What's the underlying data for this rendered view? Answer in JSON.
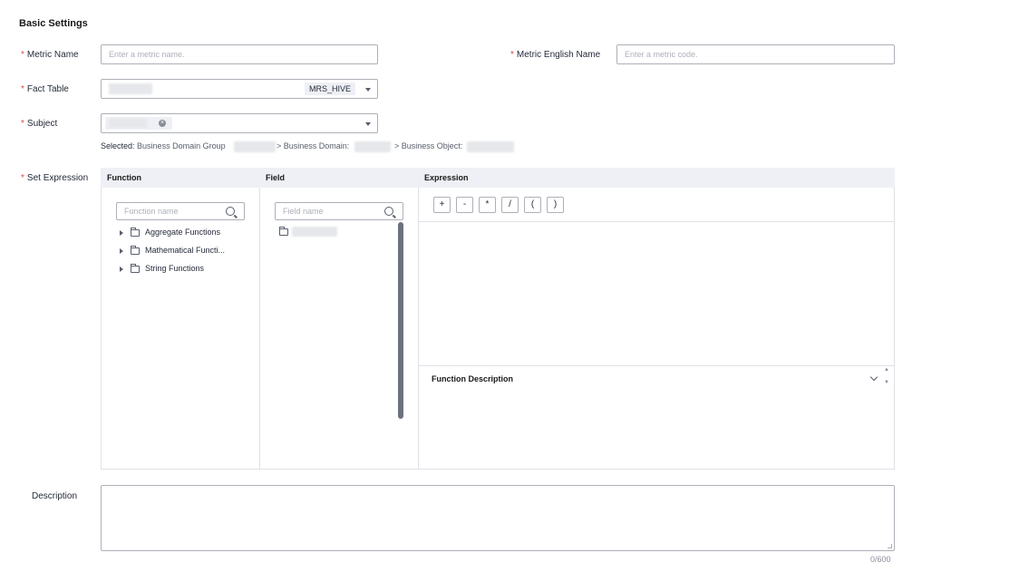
{
  "section": {
    "title": "Basic Settings"
  },
  "metric_name": {
    "label": "Metric Name",
    "placeholder": "Enter a metric name."
  },
  "metric_english_name": {
    "label": "Metric English Name",
    "placeholder": "Enter a metric code."
  },
  "fact_table": {
    "label": "Fact Table",
    "tag": "MRS_HIVE"
  },
  "subject": {
    "label": "Subject",
    "selected_prefix": "Selected:",
    "path_group": "Business Domain Group",
    "path_domain": "> Business Domain:",
    "path_object": "> Business Object:"
  },
  "expression": {
    "label": "Set Expression",
    "function_header": "Function",
    "field_header": "Field",
    "expression_header": "Expression",
    "function_search_placeholder": "Function name",
    "field_search_placeholder": "Field name",
    "functions": [
      "Aggregate Functions",
      "Mathematical Functi...",
      "String Functions"
    ],
    "operators": [
      "+",
      "-",
      "*",
      "/",
      "(",
      ")"
    ],
    "function_description_title": "Function Description"
  },
  "description": {
    "label": "Description",
    "counter": "0/600"
  },
  "colors": {
    "required": "#e54545",
    "panel_header": "#eef0f5",
    "scrollbar": "#6c7280"
  }
}
